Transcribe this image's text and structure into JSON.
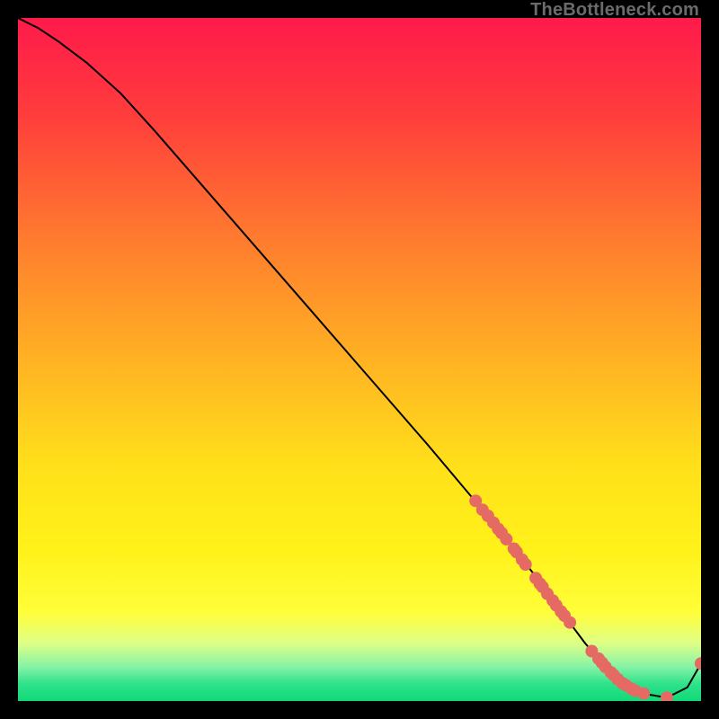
{
  "attribution": "TheBottleneck.com",
  "chart_data": {
    "type": "line",
    "title": "",
    "xlabel": "",
    "ylabel": "",
    "xlim": [
      0,
      100
    ],
    "ylim": [
      0,
      100
    ],
    "background_gradient": {
      "stops": [
        {
          "offset": 0.0,
          "color": "#ff1a4b"
        },
        {
          "offset": 0.14,
          "color": "#ff3c3c"
        },
        {
          "offset": 0.32,
          "color": "#ff7a2f"
        },
        {
          "offset": 0.5,
          "color": "#ffb223"
        },
        {
          "offset": 0.66,
          "color": "#ffe11a"
        },
        {
          "offset": 0.78,
          "color": "#fff21a"
        },
        {
          "offset": 0.87,
          "color": "#fffe3a"
        },
        {
          "offset": 0.915,
          "color": "#dfff86"
        },
        {
          "offset": 0.95,
          "color": "#86f3a6"
        },
        {
          "offset": 0.975,
          "color": "#2ee28b"
        },
        {
          "offset": 1.0,
          "color": "#10d977"
        }
      ]
    },
    "series": [
      {
        "name": "bottleneck-curve",
        "type": "line",
        "color": "#000000",
        "x": [
          0,
          3,
          6,
          10,
          15,
          20,
          30,
          40,
          50,
          60,
          68,
          72,
          76,
          80,
          83,
          86,
          89,
          92,
          95,
          98,
          100
        ],
        "y": [
          100,
          98.5,
          96.5,
          93.5,
          89.0,
          83.5,
          72.0,
          60.5,
          49.0,
          37.5,
          28.0,
          23.0,
          18.0,
          12.5,
          8.5,
          5.0,
          2.5,
          1.0,
          0.5,
          2.0,
          5.5
        ]
      },
      {
        "name": "highlight-markers",
        "type": "scatter",
        "color": "#e46a63",
        "marker_radius": 7,
        "x": [
          67.0,
          68.0,
          68.8,
          69.6,
          70.3,
          70.8,
          71.5,
          72.6,
          73.0,
          73.8,
          74.3,
          75.8,
          76.4,
          76.8,
          77.5,
          78.3,
          78.8,
          79.5,
          80.0,
          80.8,
          84.0,
          85.0,
          85.5,
          86.0,
          86.8,
          87.2,
          87.8,
          88.5,
          89.0,
          89.8,
          90.4,
          91.6,
          95.0,
          100.0
        ],
        "y": [
          29.3,
          28.0,
          27.1,
          26.1,
          25.2,
          24.6,
          23.7,
          22.3,
          21.8,
          20.7,
          20.0,
          18.0,
          17.2,
          16.7,
          15.7,
          14.7,
          14.0,
          13.1,
          12.5,
          11.5,
          7.3,
          6.2,
          5.6,
          5.0,
          4.2,
          3.8,
          3.2,
          2.6,
          2.3,
          1.8,
          1.5,
          1.1,
          0.5,
          5.5
        ]
      }
    ]
  }
}
